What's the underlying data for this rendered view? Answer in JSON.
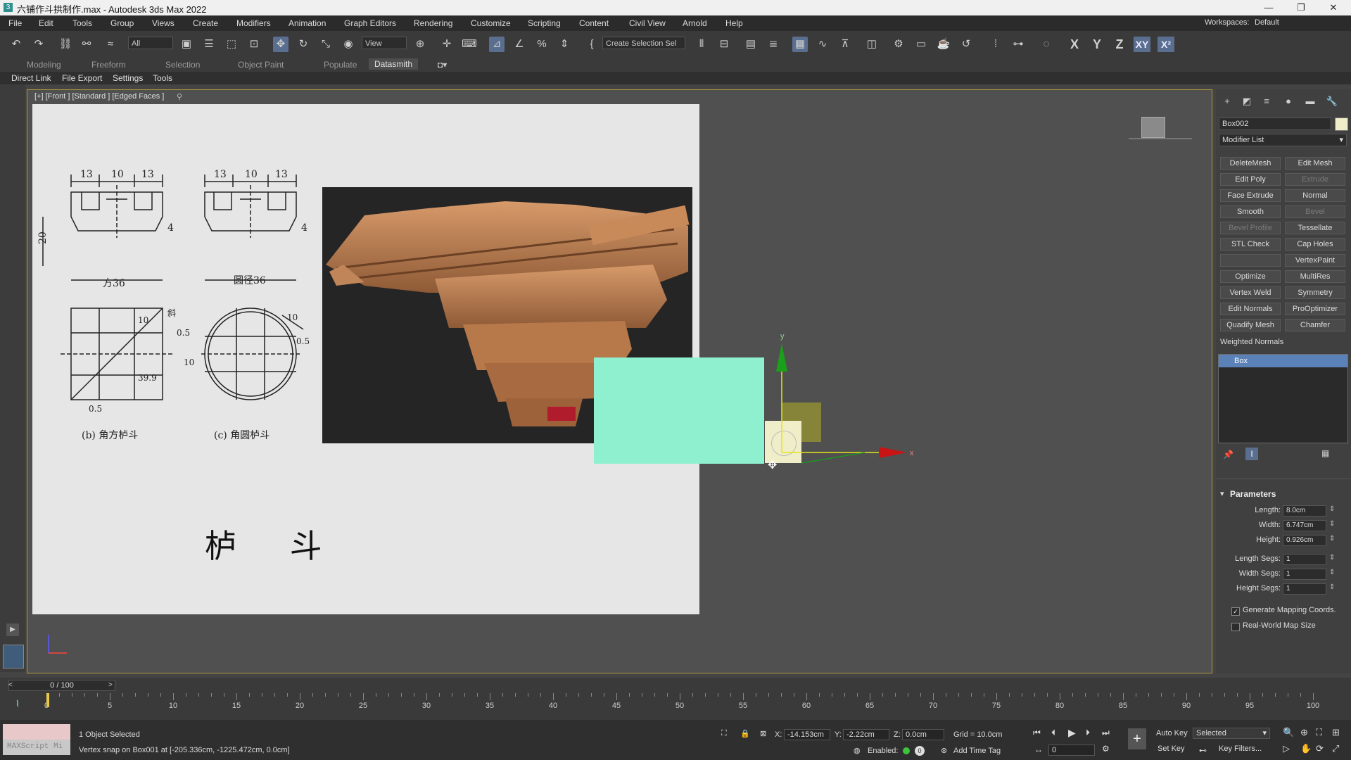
{
  "window": {
    "title": "六铺作斗拱制作.max - Autodesk 3ds Max 2022",
    "minimize": "—",
    "maximize": "❐",
    "close": "✕"
  },
  "menu": [
    "File",
    "Edit",
    "Tools",
    "Group",
    "Views",
    "Create",
    "Modifiers",
    "Animation",
    "Graph Editors",
    "Rendering",
    "Customize",
    "Scripting",
    "Content",
    "Civil View",
    "Arnold",
    "Help"
  ],
  "workspace": {
    "label": "Workspaces:",
    "value": "Default"
  },
  "toolbar": {
    "selection_filter": "All",
    "ref_coord": "View",
    "selection_set": "Create Selection Sel",
    "axes": [
      "X",
      "Y",
      "Z",
      "XY"
    ],
    "icons": [
      "undo-icon",
      "redo-icon",
      "link-icon",
      "unlink-icon",
      "bind-icon",
      "select-icon",
      "select-by-name-icon",
      "rect-select-icon",
      "window-crossing-icon",
      "move-icon",
      "rotate-icon",
      "scale-icon",
      "place-icon"
    ]
  },
  "ribbon": {
    "tabs": [
      "Modeling",
      "Freeform",
      "Selection",
      "Object Paint",
      "Populate",
      "Datasmith"
    ],
    "active": "Datasmith",
    "sub_items": [
      "Direct Link",
      "File Export",
      "Settings",
      "Tools"
    ]
  },
  "viewport": {
    "label": "[+] [Front ] [Standard ] [Edged Faces ]",
    "reference": {
      "dims_left_top": [
        "13",
        "10",
        "13"
      ],
      "dims_right_top": [
        "13",
        "10",
        "13"
      ],
      "side_dim": "20",
      "small_dim_left": "4",
      "small_dim_right": "4",
      "caption_square": "方36",
      "caption_round": "圆径36",
      "label_b": "(b) 角方栌斗",
      "label_c": "(c) 角圆栌斗",
      "title": "栌 斗",
      "annot_1": "10",
      "annot_2": "0.5",
      "annot_3": "39.9",
      "annot_4": "0.5",
      "annot_5": "10",
      "annot_6": "10",
      "annot_7": "0.5",
      "annot_8": "斜"
    },
    "gizmo_axes": {
      "x": "x",
      "y": "y"
    },
    "box_color": "#8ff0d0",
    "x_axis_color": "#c81414",
    "y_axis_color": "#1aa01a"
  },
  "command_panel": {
    "object_name": "Box002",
    "modifier_list": "Modifier List",
    "modifier_buttons": [
      {
        "label": "DeleteMesh",
        "enabled": true
      },
      {
        "label": "Edit Mesh",
        "enabled": true
      },
      {
        "label": "Edit Poly",
        "enabled": true
      },
      {
        "label": "Extrude",
        "enabled": false
      },
      {
        "label": "Face Extrude",
        "enabled": true
      },
      {
        "label": "Normal",
        "enabled": true
      },
      {
        "label": "Smooth",
        "enabled": true
      },
      {
        "label": "Bevel",
        "enabled": false
      },
      {
        "label": "Bevel Profile",
        "enabled": false
      },
      {
        "label": "Tessellate",
        "enabled": true
      },
      {
        "label": "STL Check",
        "enabled": true
      },
      {
        "label": "Cap Holes",
        "enabled": true
      },
      {
        "label": "",
        "enabled": true
      },
      {
        "label": "VertexPaint",
        "enabled": true
      },
      {
        "label": "Optimize",
        "enabled": true
      },
      {
        "label": "MultiRes",
        "enabled": true
      },
      {
        "label": "Vertex Weld",
        "enabled": true
      },
      {
        "label": "Symmetry",
        "enabled": true
      },
      {
        "label": "Edit Normals",
        "enabled": true
      },
      {
        "label": "ProOptimizer",
        "enabled": true
      },
      {
        "label": "Quadify Mesh",
        "enabled": true
      },
      {
        "label": "Chamfer",
        "enabled": true
      }
    ],
    "weighted_normals": "Weighted Normals",
    "stack_item": "Box",
    "parameters_title": "Parameters",
    "params": [
      {
        "label": "Length:",
        "value": "8.0cm"
      },
      {
        "label": "Width:",
        "value": "6.747cm"
      },
      {
        "label": "Height:",
        "value": "0.926cm"
      },
      {
        "label": "Length Segs:",
        "value": "1"
      },
      {
        "label": "Width Segs:",
        "value": "1"
      },
      {
        "label": "Height Segs:",
        "value": "1"
      }
    ],
    "gen_mapping": "Generate Mapping Coords.",
    "gen_mapping_checked": true,
    "real_world": "Real-World Map Size",
    "real_world_checked": false
  },
  "timeline": {
    "frame": "0 / 100",
    "ticks": [
      "0",
      "5",
      "10",
      "15",
      "20",
      "25",
      "30",
      "35",
      "40",
      "45",
      "50",
      "55",
      "60",
      "65",
      "70",
      "75",
      "80",
      "85",
      "90",
      "95",
      "100"
    ]
  },
  "status": {
    "maxscript": "MAXScript Mi",
    "selected": "1 Object Selected",
    "prompt": "Vertex snap on Box001 at [-205.336cm, -1225.472cm, 0.0cm]",
    "x_label": "X:",
    "x": "-14.153cm",
    "y_label": "Y:",
    "y": "-2.22cm",
    "z_label": "Z:",
    "z": "0.0cm",
    "grid": "Grid = 10.0cm",
    "enabled": "Enabled:",
    "add_time_tag": "Add Time Tag",
    "auto_key": "Auto Key",
    "set_key": "Set Key",
    "selected_dd": "Selected",
    "key_filters": "Key Filters...",
    "frame_field": "0"
  }
}
